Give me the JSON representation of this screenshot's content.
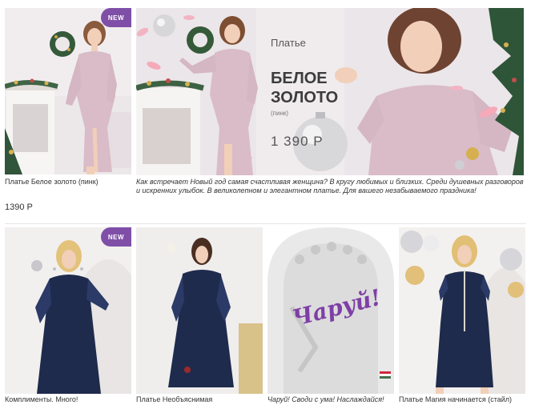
{
  "row1": {
    "card1": {
      "badge": "NEW",
      "caption": "Платье Белое золото (пинк)",
      "price": "1390 Р"
    },
    "banner": {
      "title_small": "Платье",
      "title_line1": "БЕЛОЕ",
      "title_line2": "ЗОЛОТО",
      "subtitle": "(пинк)",
      "price": "1 390 Р",
      "caption": "Как встречает Новый год самая счастливая женщина? В кругу любимых и близких. Среди душевных разговоров и искренних улыбок. В великолепном и элегантном платье. Для вашего незабываемого праздника!"
    }
  },
  "row2": {
    "card1": {
      "badge": "NEW",
      "caption": "Комплименты. Много!"
    },
    "card2": {
      "caption": "Платье Необъяснимая"
    },
    "card3": {
      "word": "Чаруй!",
      "caption": "Чаруй! Своди с ума! Наслаждайся!"
    },
    "card4": {
      "caption": "Платье Магия начинается (стайл)"
    }
  },
  "colors": {
    "accent_purple": "#7f4fa8",
    "dress_pink": "#d9bcc8",
    "dress_navy": "#1f2b4d"
  }
}
